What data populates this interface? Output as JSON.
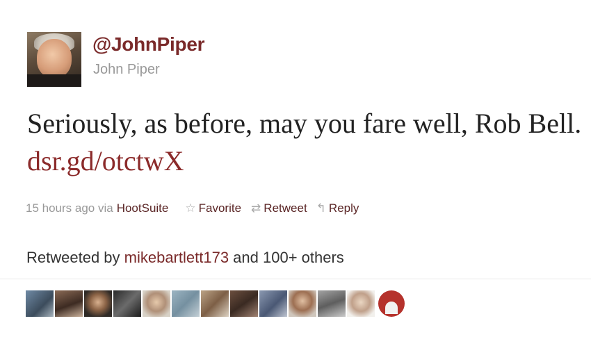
{
  "author": {
    "handle": "@JohnPiper",
    "name": "John Piper"
  },
  "tweet": {
    "text": "Seriously, as before, may you fare well, Rob Bell. ",
    "link": "dsr.gd/otctwX"
  },
  "meta": {
    "time_via": "15 hours ago via",
    "source": "HootSuite",
    "favorite_label": "Favorite",
    "retweet_label": "Retweet",
    "reply_label": "Reply"
  },
  "retweets": {
    "prefix": "Retweeted by ",
    "user": "mikebartlett173",
    "suffix": " and 100+ others"
  },
  "icons": {
    "favorite": "star-icon",
    "retweet": "retweet-icon",
    "reply": "reply-icon"
  },
  "colors": {
    "link": "#8b2a2a",
    "handle": "#7a2a2a",
    "muted": "#999999"
  }
}
